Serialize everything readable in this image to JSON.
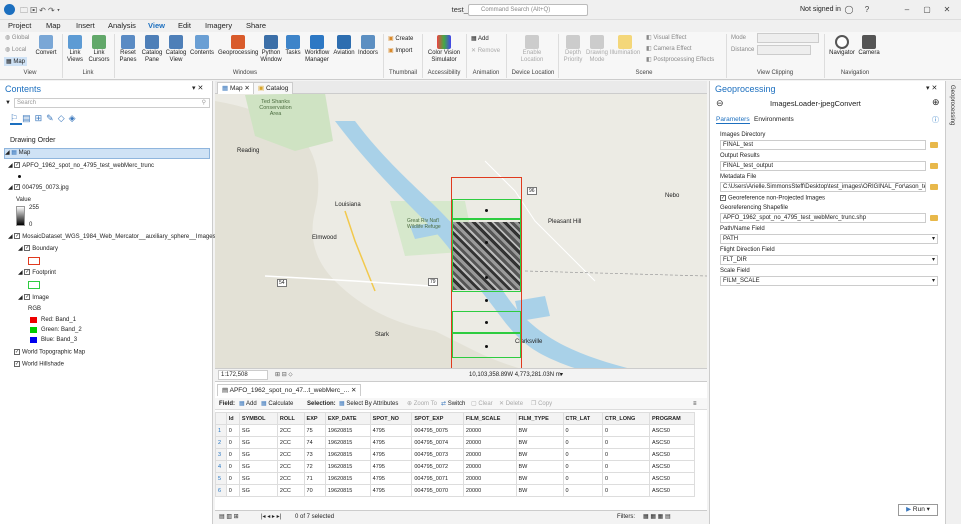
{
  "window": {
    "title": "test_images_v09",
    "search_placeholder": "Command Search (Alt+Q)",
    "signin": "Not signed in"
  },
  "menu": [
    "Project",
    "Map",
    "Insert",
    "Analysis",
    "View",
    "Edit",
    "Imagery",
    "Share"
  ],
  "ribbon": {
    "view_small": [
      "Global",
      "Local",
      "Map"
    ],
    "convert": "Convert",
    "link_views": "Link\nViews",
    "link_cursors": "Link\nCursors",
    "reset_panes": "Reset\nPanes",
    "catalog_pane": "Catalog\nPane",
    "catalog_view": "Catalog\nView",
    "contents": "Contents",
    "geoprocessing": "Geoprocessing",
    "python_window": "Python\nWindow",
    "tasks": "Tasks",
    "workflow_manager": "Workflow\nManager",
    "aviation": "Aviation",
    "indoors": "Indoors",
    "create": "Create",
    "import": "Import",
    "color_vision": "Color Vision\nSimulator",
    "add": "Add",
    "remove": "Remove",
    "enable_location": "Enable\nLocation",
    "depth_priority": "Depth\nPriority",
    "drawing_mode": "Drawing\nMode",
    "illumination": "Illumination",
    "visual_effect": "Visual Effect",
    "camera_effect": "Camera Effect",
    "postprocessing": "Postprocessing Effects",
    "mode": "Mode",
    "distance": "Distance",
    "navigator": "Navigator",
    "camera": "Camera",
    "groups": [
      "View",
      "Link",
      "Windows",
      "Thumbnail",
      "Accessibility",
      "Animation",
      "Device Location",
      "Scene",
      "View Clipping",
      "Navigation"
    ]
  },
  "contents": {
    "title": "Contents",
    "search_placeholder": "Search",
    "drawing_order": "Drawing Order",
    "items": {
      "map": "Map",
      "layer1": "APFO_1962_spot_no_4795_test_webMerc_trunc",
      "layer2": "004795_0073.jpg",
      "value": "Value",
      "val_high": "255",
      "val_low": "0",
      "mosaic": "MosaicDataset_WGS_1984_Web_Mercator__auxiliary_sphere__Images",
      "boundary": "Boundary",
      "footprint": "Footprint",
      "image": "Image",
      "rgb": "RGB",
      "red": "Red:  Band_1",
      "green": "Green: Band_2",
      "blue": "Blue:  Band_3",
      "topo": "World Topographic Map",
      "hillshade": "World Hillshade"
    }
  },
  "map": {
    "tabs": [
      "Map",
      "Catalog"
    ],
    "labels": {
      "conservation": "Ted Shanks\nConservation\nArea",
      "reading": "Reading",
      "louisiana": "Louisiana",
      "elmwood": "Elmwood",
      "great_river": "Great Riv Nat'l\nWildlife Refuge",
      "pleasant_hill": "Pleasant Hill",
      "nebo": "Nebo",
      "stark": "Stark",
      "clarksville": "Clarksville",
      "hwy_54": "54",
      "hwy_79": "79",
      "hwy_96": "96"
    },
    "scale": "1:172,508",
    "coords": "10,103,358.89W 4,773,281.03N m"
  },
  "attr": {
    "tab": "APFO_1962_spot_no_47...t_webMerc_...",
    "field_label": "Field:",
    "add": "Add",
    "calculate": "Calculate",
    "selection_label": "Selection:",
    "select_by_attr": "Select By Attributes",
    "zoom_to": "Zoom To",
    "switch": "Switch",
    "clear": "Clear",
    "delete": "Delete",
    "copy": "Copy",
    "columns": [
      "",
      "Id",
      "SYMBOL",
      "ROLL",
      "EXP",
      "EXP_DATE",
      "SPOT_NO",
      "SPOT_EXP",
      "FILM_SCALE",
      "FILM_TYPE",
      "CTR_LAT",
      "CTR_LONG",
      "PROGRAM"
    ],
    "rows": [
      [
        "1",
        "0",
        "SG",
        "2CC",
        "75",
        "19620815",
        "4795",
        "004795_0075",
        "20000",
        "BW",
        "0",
        "0",
        "ASCS0"
      ],
      [
        "2",
        "0",
        "SG",
        "2CC",
        "74",
        "19620815",
        "4795",
        "004795_0074",
        "20000",
        "BW",
        "0",
        "0",
        "ASCS0"
      ],
      [
        "3",
        "0",
        "SG",
        "2CC",
        "73",
        "19620815",
        "4795",
        "004795_0073",
        "20000",
        "BW",
        "0",
        "0",
        "ASCS0"
      ],
      [
        "4",
        "0",
        "SG",
        "2CC",
        "72",
        "19620815",
        "4795",
        "004795_0072",
        "20000",
        "BW",
        "0",
        "0",
        "ASCS0"
      ],
      [
        "5",
        "0",
        "SG",
        "2CC",
        "71",
        "19620815",
        "4795",
        "004795_0071",
        "20000",
        "BW",
        "0",
        "0",
        "ASCS0"
      ],
      [
        "6",
        "0",
        "SG",
        "2CC",
        "70",
        "19620815",
        "4795",
        "004795_0070",
        "20000",
        "BW",
        "0",
        "0",
        "ASCS0"
      ]
    ],
    "status": "0 of 7 selected",
    "filters": "Filters:"
  },
  "geo": {
    "title": "Geoprocessing",
    "tool": "ImagesLoader-jpegConvert",
    "tabs": [
      "Parameters",
      "Environments"
    ],
    "images_dir_label": "Images Directory",
    "images_dir": "FINAL_test",
    "output_label": "Output Results",
    "output": "FINAL_test_output",
    "metadata_label": "Metadata File",
    "metadata": "C:\\Users\\Arielle.SimmonsSteff\\Desktop\\test_images\\ORIGINAL_For\\ason_test",
    "georef_checkbox": "Georeference non-Projected Images",
    "shapefile_label": "Georeferencing Shapefile",
    "shapefile": "APFO_1962_spot_no_4795_test_webMerc_trunc.shp",
    "path_label": "Path/Name Field",
    "path": "PATH",
    "flight_label": "Flight Direction Field",
    "flight": "FLT_DIR",
    "scale_label": "Scale Field",
    "scale": "FILM_SCALE",
    "run": "Run"
  },
  "sidebar_right": "Geoprocessing",
  "colors": {
    "accent": "#1c6fbf",
    "water": "#a9d1e8",
    "park": "#cfe3c3",
    "footprint": "#2ecc40",
    "boundary": "#e03a1e"
  }
}
